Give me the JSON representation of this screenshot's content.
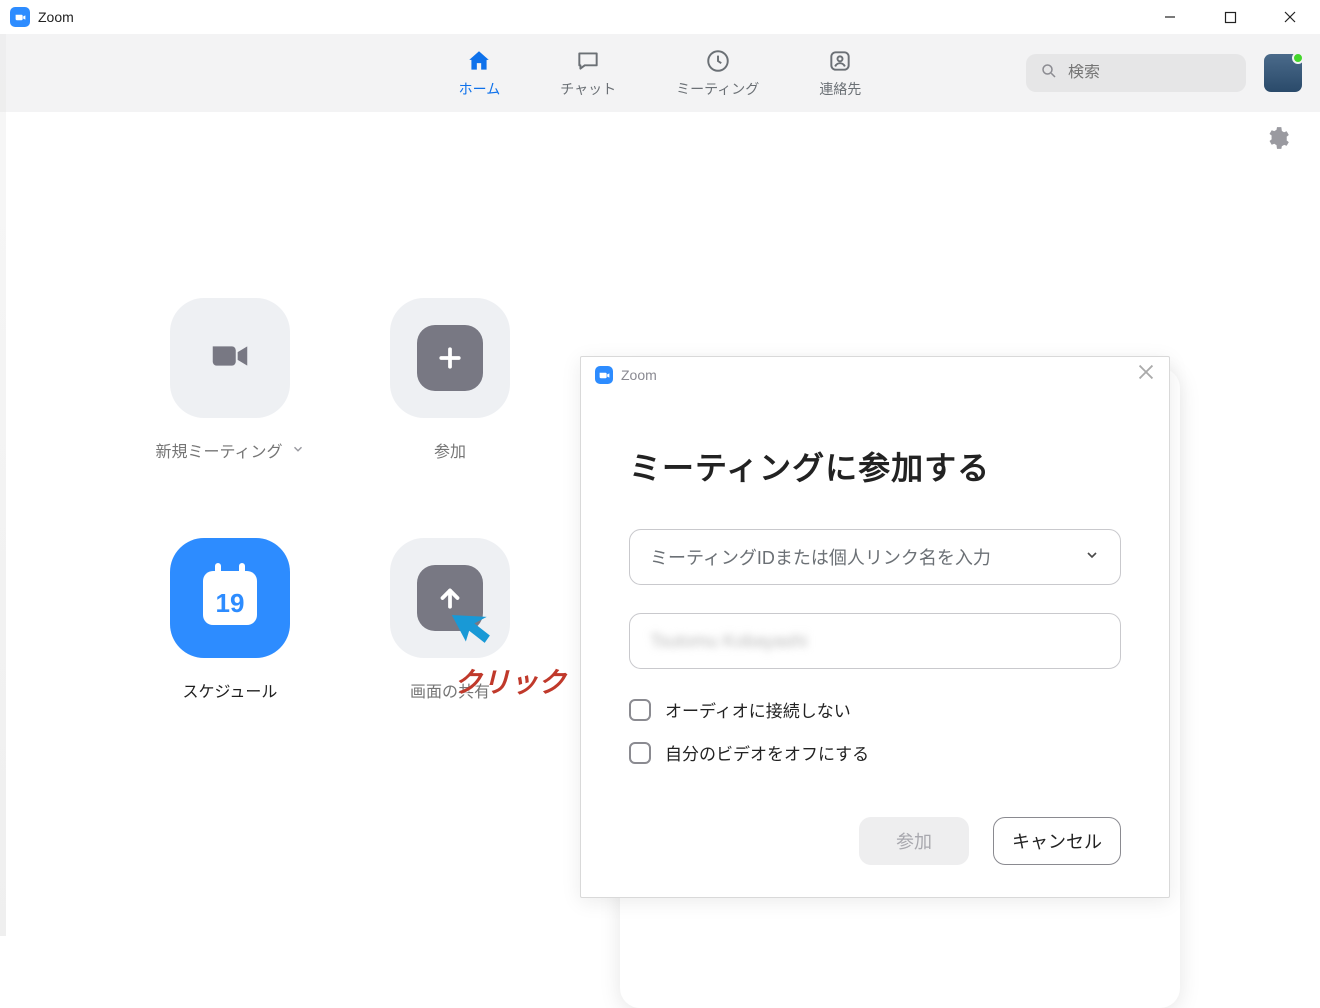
{
  "titlebar": {
    "app_name": "Zoom"
  },
  "nav": {
    "items": [
      {
        "label": "ホーム"
      },
      {
        "label": "チャット"
      },
      {
        "label": "ミーティング"
      },
      {
        "label": "連絡先"
      }
    ],
    "search_placeholder": "検索"
  },
  "tiles": {
    "new_meeting": "新規ミーティング",
    "join": "参加",
    "schedule": "スケジュール",
    "schedule_day": "19",
    "share_screen": "画面の共有"
  },
  "annotation": {
    "label": "クリック"
  },
  "dialog": {
    "window_title": "Zoom",
    "heading": "ミーティングに参加する",
    "meeting_id_placeholder": "ミーティングIDまたは個人リンク名を入力",
    "name_value": "Tsutomu Kobayashi",
    "check_audio_label": "オーディオに接続しない",
    "check_video_label": "自分のビデオをオフにする",
    "join_btn": "参加",
    "cancel_btn": "キャンセル"
  }
}
